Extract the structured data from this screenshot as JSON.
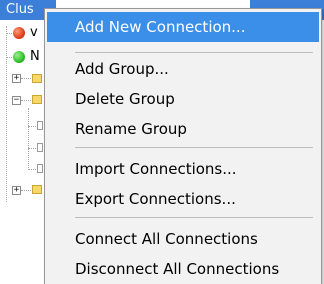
{
  "tree": {
    "header_label": "Clus",
    "nodes": [
      {
        "status": "red",
        "label": "v"
      },
      {
        "status": "green",
        "label": "N"
      }
    ]
  },
  "context_menu": {
    "groups": [
      {
        "items": [
          {
            "label": "Add New Connection...",
            "highlighted": true
          }
        ]
      },
      {
        "items": [
          {
            "label": "Add Group..."
          },
          {
            "label": "Delete Group"
          },
          {
            "label": "Rename Group"
          }
        ]
      },
      {
        "items": [
          {
            "label": "Import Connections..."
          },
          {
            "label": "Export Connections..."
          }
        ]
      },
      {
        "items": [
          {
            "label": "Connect All Connections"
          },
          {
            "label": "Disconnect All Connections"
          }
        ]
      }
    ]
  },
  "colors": {
    "highlight": "#3c8fe8",
    "header": "#3b7fd8",
    "menu_background": "#f2f2f2",
    "status_red": "#e0401c",
    "status_green": "#2fbf2a"
  },
  "icons": {
    "expand": "plus-box-icon",
    "collapse": "minus-box-icon",
    "folder": "folder-icon",
    "connection": "document-icon"
  }
}
